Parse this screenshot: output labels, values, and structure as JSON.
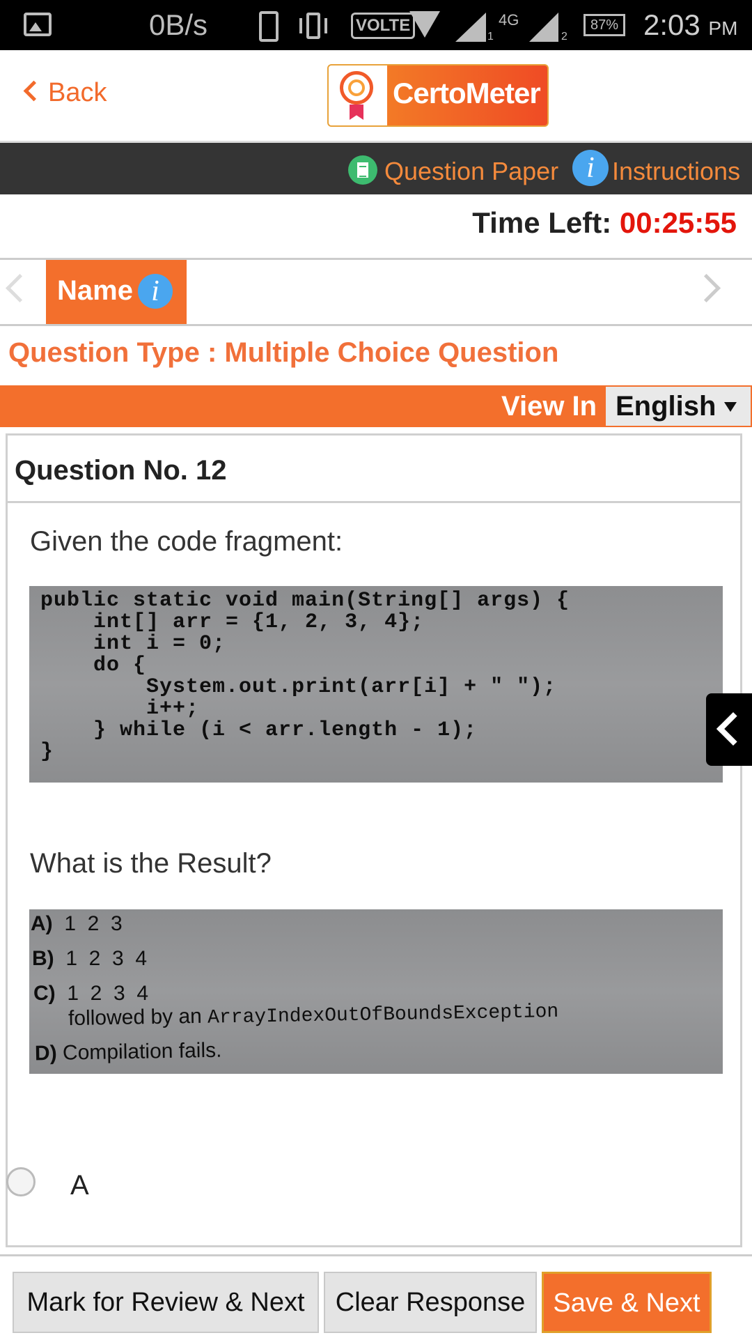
{
  "status_bar": {
    "net_speed": "0B/s",
    "volte": "VOLTE",
    "network": "4G",
    "sim1": "1",
    "sim2": "2",
    "battery": "87%",
    "time": "2:03",
    "ampm": "PM"
  },
  "header": {
    "back_label": "Back",
    "logo_text": "CertoMeter"
  },
  "toolbar": {
    "question_paper_label": "Question Paper",
    "instructions_label": "Instructions",
    "instructions_icon": "i"
  },
  "timer": {
    "label": "Time Left:",
    "value": "00:25:55"
  },
  "section": {
    "tab_label": "Name",
    "info_icon": "i"
  },
  "question_type": "Question Type : Multiple Choice Question",
  "view_in": {
    "label": "View In",
    "selected_language": "English"
  },
  "question": {
    "number_label": "Question No. 12",
    "intro_text": "Given the code fragment:",
    "code_lines": [
      "public static void main(String[] args) {",
      "    int[] arr = {1, 2, 3, 4};",
      "    int i = 0;",
      "    do {",
      "        System.out.print(arr[i] + \" \");",
      "        i++;",
      "    } while (i < arr.length - 1);",
      "}"
    ],
    "prompt_text": "What is the Result?",
    "options_image": {
      "a_letter": "A)",
      "a_text": "1  2  3",
      "b_letter": "B)",
      "b_text": "1  2  3  4",
      "c_letter": "C)",
      "c_text": "1  2  3  4",
      "c_text2": "followed by an",
      "c_text3": "ArrayIndexOutOfBoundsException",
      "d_letter": "D)",
      "d_text": "Compilation fails."
    },
    "answer_option_a": "A"
  },
  "footer": {
    "mark_review_label": "Mark for Review & Next",
    "clear_label": "Clear Response",
    "save_label": "Save & Next"
  },
  "colors": {
    "accent": "#f36f2c",
    "timer_red": "#e3150b",
    "dark_bar": "#343434",
    "info_blue": "#4aa6ef"
  }
}
